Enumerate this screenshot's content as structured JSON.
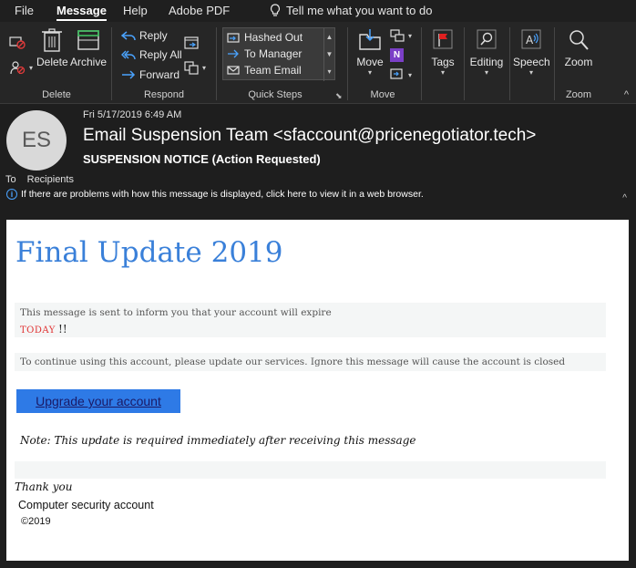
{
  "menubar": {
    "tabs": [
      "File",
      "Message",
      "Help",
      "Adobe PDF"
    ],
    "tell_me": "Tell me what you want to do"
  },
  "ribbon": {
    "delete_group": {
      "label": "Delete",
      "delete": "Delete",
      "archive": "Archive"
    },
    "respond_group": {
      "label": "Respond",
      "reply": "Reply",
      "reply_all": "Reply All",
      "forward": "Forward"
    },
    "quick_steps_group": {
      "label": "Quick Steps",
      "items": [
        "Hashed Out",
        "To Manager",
        "Team Email"
      ]
    },
    "move_group": {
      "label": "Move",
      "move": "Move"
    },
    "tags": "Tags",
    "editing": "Editing",
    "speech": "Speech",
    "zoom_group": {
      "label": "Zoom",
      "zoom": "Zoom"
    }
  },
  "message": {
    "avatar_initials": "ES",
    "date": "Fri 5/17/2019 6:49 AM",
    "sender": "Email Suspension Team <sfaccount@pricenegotiator.tech>",
    "subject": "SUSPENSION NOTICE (Action Requested)",
    "to_label": "To",
    "recipients": "Recipients",
    "info_bar": "If there are problems with how this message is displayed, click here to view it in a web browser."
  },
  "body": {
    "headline": "Final Update 2019",
    "line1": "This message is sent to inform you that your account will expire",
    "today": "TODAY",
    "exclaim": "!!",
    "line2": "To continue using this account, please update our services. Ignore this message will cause the account is closed",
    "button": "Upgrade your account",
    "note": "Note: This update is required immediately after receiving this message",
    "thanks": "Thank you",
    "signature": "Computer security account",
    "copyright": "©2019"
  },
  "colors": {
    "headline": "#3a80d9",
    "button": "#2e7ae6",
    "today": "#e03131",
    "flag": "#e02020",
    "onenote": "#7b3fc7"
  }
}
